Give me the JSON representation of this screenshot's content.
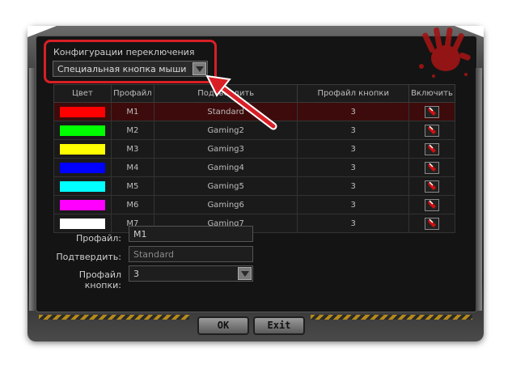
{
  "config": {
    "title": "Конфигурации переключения",
    "selected": "Специальная кнопка мыши"
  },
  "table": {
    "headers": [
      "Цвет",
      "Профайл",
      "Подтвердить",
      "Профайл кнопки",
      "Включить"
    ],
    "rows": [
      {
        "color": "#ff0000",
        "profile": "M1",
        "name": "Standard",
        "button_profile": "3",
        "selected": true
      },
      {
        "color": "#00ff00",
        "profile": "M2",
        "name": "Gaming2",
        "button_profile": "3"
      },
      {
        "color": "#ffff00",
        "profile": "M3",
        "name": "Gaming3",
        "button_profile": "3"
      },
      {
        "color": "#0000ff",
        "profile": "M4",
        "name": "Gaming4",
        "button_profile": "3"
      },
      {
        "color": "#00ffff",
        "profile": "M5",
        "name": "Gaming5",
        "button_profile": "3"
      },
      {
        "color": "#ff00ff",
        "profile": "M6",
        "name": "Gaming6",
        "button_profile": "3"
      },
      {
        "color": "#ffffff",
        "profile": "M7",
        "name": "Gaming7",
        "button_profile": "3"
      }
    ]
  },
  "form": {
    "profile_label": "Профайл:",
    "profile_value": "M1",
    "confirm_label": "Подтвердить:",
    "confirm_value": "Standard",
    "button_profile_label": "Профайл кнопки:",
    "button_profile_value": "3"
  },
  "buttons": {
    "ok": "OK",
    "exit": "Exit"
  },
  "colors": {
    "highlight": "#d91f26",
    "selected_row": "#3d0b0b"
  }
}
